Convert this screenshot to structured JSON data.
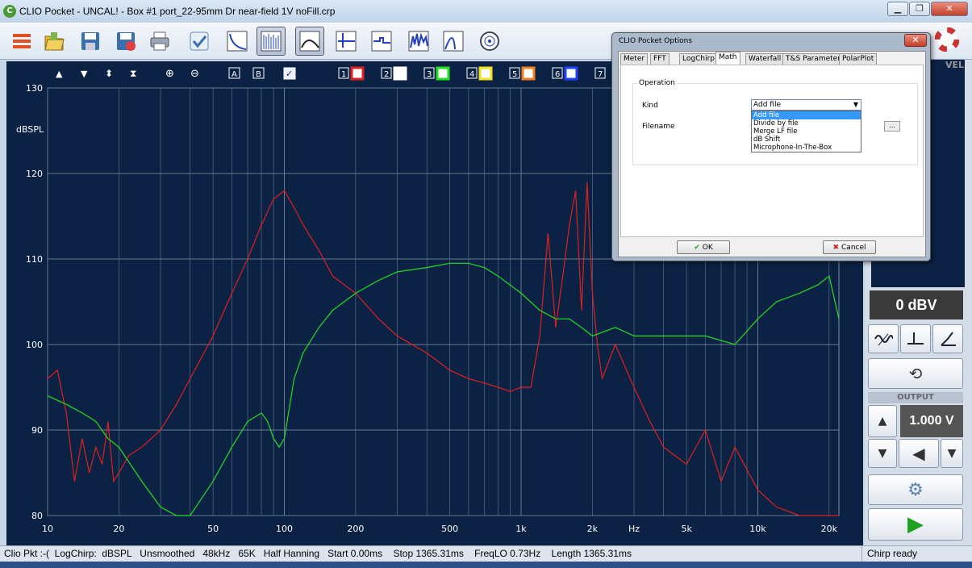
{
  "window": {
    "title": "CLIO Pocket - UNCAL! - Box #1 port_22-95mm Dr near-field 1V noFill.crp",
    "app_icon_letter": "C",
    "minimize": "▁",
    "maximize": "❐",
    "close": "✕"
  },
  "toolbar": {
    "icons": [
      "menu-icon",
      "open-folder-icon",
      "save-icon",
      "save-as-icon",
      "print-icon",
      "checkmark-icon",
      "graph-log-icon",
      "graph-waterfall-icon",
      "graph-response-icon",
      "graph-impulse-icon",
      "graph-step-icon",
      "graph-spectrogram-icon",
      "graph-impulse-peak-icon",
      "polar-icon"
    ]
  },
  "plot_toolbar": {
    "arrows": [
      "▲",
      "▼",
      "⬍",
      "⧗"
    ],
    "zoom_in": "⊕",
    "zoom_out": "⊖",
    "cursor_a": "A",
    "cursor_b": "B",
    "check_label": "✓",
    "overlays": [
      "1",
      "2",
      "3",
      "4",
      "5",
      "6",
      "7"
    ]
  },
  "chart_data": {
    "type": "line",
    "ylabel": "dBSPL",
    "xlabel": "Hz",
    "xscale": "log",
    "xlim": [
      10,
      22000
    ],
    "ylim": [
      80,
      130
    ],
    "xticks": [
      "10",
      "20",
      "50",
      "100",
      "200",
      "500",
      "1k",
      "2k",
      "Hz",
      "5k",
      "10k",
      "20k"
    ],
    "yticks": [
      "130",
      "120",
      "110",
      "100",
      "90",
      "80"
    ],
    "grid": true,
    "series": [
      {
        "color": "#e02020",
        "x": [
          10,
          11,
          12,
          13,
          14,
          15,
          16,
          17,
          18,
          19,
          20,
          22,
          25,
          30,
          35,
          40,
          50,
          60,
          70,
          80,
          90,
          100,
          110,
          120,
          140,
          160,
          200,
          250,
          300,
          400,
          500,
          600,
          700,
          800,
          900,
          1000,
          1100,
          1200,
          1300,
          1400,
          1500,
          1600,
          1700,
          1800,
          1900,
          2000,
          2100,
          2200,
          2500,
          3000,
          3500,
          4000,
          5000,
          6000,
          7000,
          8000,
          10000,
          12000,
          15000,
          20000,
          22000
        ],
        "y": [
          96,
          97,
          92,
          84,
          89,
          85,
          88,
          86,
          91,
          84,
          85,
          87,
          88,
          90,
          93,
          96,
          101,
          106,
          110,
          114,
          117,
          118,
          116,
          114,
          111,
          108,
          106,
          103,
          101,
          99,
          97,
          96,
          95.5,
          95,
          94.5,
          95,
          95,
          101,
          113,
          102,
          108,
          114,
          118,
          104,
          119,
          106,
          100,
          96,
          100,
          95,
          91,
          88,
          86,
          90,
          84,
          88,
          83,
          81,
          80,
          80,
          80
        ]
      },
      {
        "color": "#20e020",
        "x": [
          10,
          12,
          14,
          16,
          18,
          20,
          25,
          30,
          35,
          40,
          50,
          60,
          70,
          80,
          85,
          90,
          95,
          100,
          110,
          120,
          140,
          160,
          200,
          250,
          300,
          400,
          500,
          600,
          700,
          800,
          1000,
          1200,
          1400,
          1600,
          1800,
          2000,
          2500,
          3000,
          3500,
          4000,
          5000,
          6000,
          8000,
          10000,
          12000,
          15000,
          18000,
          20000,
          22000
        ],
        "y": [
          94,
          93,
          92,
          91,
          89,
          88,
          84,
          81,
          80,
          80,
          84,
          88,
          91,
          92,
          91,
          89,
          88,
          89,
          96,
          99,
          102,
          104,
          106,
          107.5,
          108.5,
          109,
          109.5,
          109.5,
          109,
          108,
          106,
          104,
          103,
          103,
          102,
          101,
          102,
          101,
          101,
          101,
          101,
          101,
          100,
          103,
          105,
          106,
          107,
          108,
          103
        ]
      }
    ]
  },
  "right_panel": {
    "level_label": "VEL",
    "input_readout": "0 dBV",
    "output_label": "OUTPUT",
    "output_readout": "1.000 V",
    "up_arrow": "▲",
    "down_arrow": "▼",
    "loop_symbol": "⟲",
    "gear_symbol": "⚙",
    "play_symbol": "▶",
    "speaker_symbol": "◀"
  },
  "status": {
    "left": "Clio Pkt :-(  LogChirp:  dBSPL   Unsmoothed   48kHz   65K   Half Hanning   Start 0.00ms    Stop 1365.31ms    FreqLO 0.73Hz    Length 1365.31ms",
    "right": "Chirp ready"
  },
  "dialog": {
    "title": "CLIO Pocket Options",
    "close": "✕",
    "tabs": [
      "Meter",
      "FFT",
      "LogChirp",
      "Math",
      "Waterfall",
      "T&S Parameters",
      "PolarPlot"
    ],
    "selected_tab": "Math",
    "group_label": "Operation",
    "kind_label": "Kind",
    "filename_label": "Filename",
    "kind_value": "Add file",
    "kind_options": [
      "Add file",
      "Divide by file",
      "Merge LF file",
      "dB Shift",
      "Microphone-In-The-Box"
    ],
    "browse_label": "...",
    "ok_label": "OK",
    "cancel_label": "Cancel"
  }
}
